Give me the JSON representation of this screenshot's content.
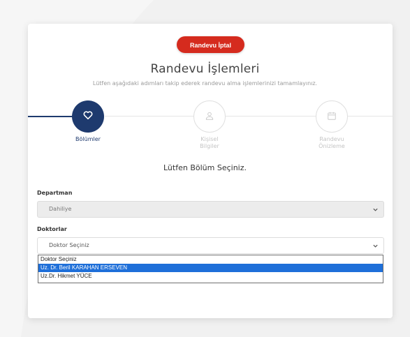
{
  "header": {
    "cancel_button": "Randevu İptal",
    "title": "Randevu İşlemleri",
    "subtitle": "Lütfen aşağıdaki adımları takip ederek randevu alma işlemlerinizi tamamlayınız."
  },
  "steps": [
    {
      "label": "Bölümler",
      "icon": "heart-icon",
      "state": "active"
    },
    {
      "label_line1": "Kişisel",
      "label_line2": "Bilgiler",
      "icon": "user-icon",
      "state": "inactive"
    },
    {
      "label_line1": "Randevu",
      "label_line2": "Önizleme",
      "icon": "calendar-icon",
      "state": "inactive"
    }
  ],
  "prompt": "Lütfen Bölüm Seçiniz.",
  "department": {
    "label": "Departman",
    "value": "Dahiliye"
  },
  "doctors": {
    "label": "Doktorlar",
    "value": "Doktor Seçiniz",
    "options": [
      "Doktor Seçiniz",
      "Uz. Dr. Beril KARAHAN ERSEVEN",
      "Uz.Dr. Hikmet YÜCE"
    ],
    "highlighted_index": 1
  },
  "colors": {
    "primary": "#1e3a6e",
    "cancel": "#d52b1e",
    "highlight": "#1e6fd9"
  }
}
